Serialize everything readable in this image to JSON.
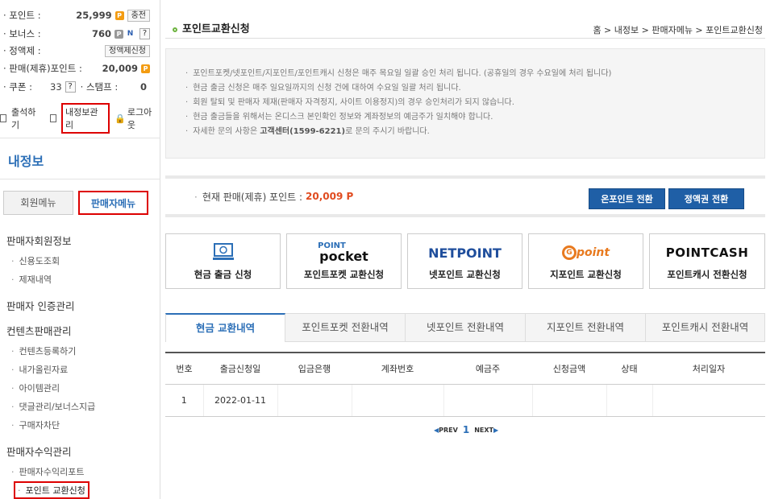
{
  "sidebar": {
    "stats": {
      "point_label": "· 포인트 :",
      "point_value": "25,999",
      "charge_btn": "충전",
      "bonus_label": "· 보너스 :",
      "bonus_value": "760",
      "voucher_label": "· 정액제 :",
      "voucher_btn": "정액제신청",
      "seller_label": "· 판매(제휴)포인트 :",
      "seller_value": "20,009",
      "coupon_label": "· 쿠폰 :",
      "coupon_value": "33",
      "stamp_label": "· 스탬프 :",
      "stamp_value": "0"
    },
    "links": {
      "attend": "출석하기",
      "myinfo": "내정보관리",
      "logout": "로그아웃"
    },
    "title": "내정보",
    "tabs": {
      "member": "회원메뉴",
      "seller": "판매자메뉴"
    },
    "menu": {
      "h1": "판매자회원정보",
      "h1_s1": "신용도조회",
      "h1_s2": "제재내역",
      "h2": "판매자 인증관리",
      "h3": "컨텐츠판매관리",
      "h3_s1": "컨텐츠등록하기",
      "h3_s2": "내가올린자료",
      "h3_s3": "아이템관리",
      "h3_s4": "댓글관리/보너스지급",
      "h3_s5": "구매자차단",
      "h4": "판매자수익관리",
      "h4_s1": "판매자수익리포트",
      "h4_s2": "포인트 교환신청"
    }
  },
  "main": {
    "title": "포인트교환신청",
    "breadcrumb": "홈 > 내정보 > 판매자메뉴 > 포인트교환신청",
    "notices": [
      "포인트포켓/넷포인트/지포인트/포인트캐시 신청은 매주 목요일 일괄 승인 처리 됩니다. (공휴일의 경우 수요일에 처리 됩니다)",
      "현금 출금 신청은 매주 일요일까지의 신청 건에 대하여 수요일 일괄 처리 됩니다.",
      "회원 탈퇴 및 판매자 제재(판매자 자격정지, 사이트 이용정지)의 경우 승인처리가 되지 않습니다.",
      "현금 출금들을 위해서는 온디스크 본인확인 정보와 계좌정보의 예금주가 일치해야 합니다."
    ],
    "notice5_pre": "자세한 문의 사항은 ",
    "notice5_bold": "고객센터(1599-6221)",
    "notice5_post": "로 문의 주시기 바랍니다.",
    "current_label": "현재 판매(제휴) 포인트 :",
    "current_value": "20,009 P",
    "btn_onpoint": "온포인트 전환",
    "btn_voucher": "정액권 전환",
    "cards": {
      "cash": "현금 출금 신청",
      "pocket_logo_top": "POINT",
      "pocket_logo_bot": "pocket",
      "pocket": "포인트포켓 교환신청",
      "net_logo": "NETPOINT",
      "net": "넷포인트 교환신청",
      "g_logo": "point",
      "g": "지포인트 교환신청",
      "cash2_logo": "POINTCASH",
      "cash2": "포인트캐시 전환신청"
    },
    "tabs": [
      "현금 교환내역",
      "포인트포켓 전환내역",
      "넷포인트 전환내역",
      "지포인트 전환내역",
      "포인트캐시 전환내역"
    ],
    "table": {
      "headers": [
        "번호",
        "출금신청일",
        "입금은행",
        "계좌번호",
        "예금주",
        "신청금액",
        "상태",
        "처리일자"
      ],
      "rows": [
        [
          "1",
          "2022-01-11",
          "",
          "",
          "",
          "",
          "",
          ""
        ]
      ]
    },
    "pager": {
      "prev": "PREV",
      "page": "1",
      "next": "NEXT"
    }
  },
  "colors": {
    "accent": "#2c6fb7",
    "button": "#1f5fa6",
    "highlight": "#e04b1f"
  }
}
